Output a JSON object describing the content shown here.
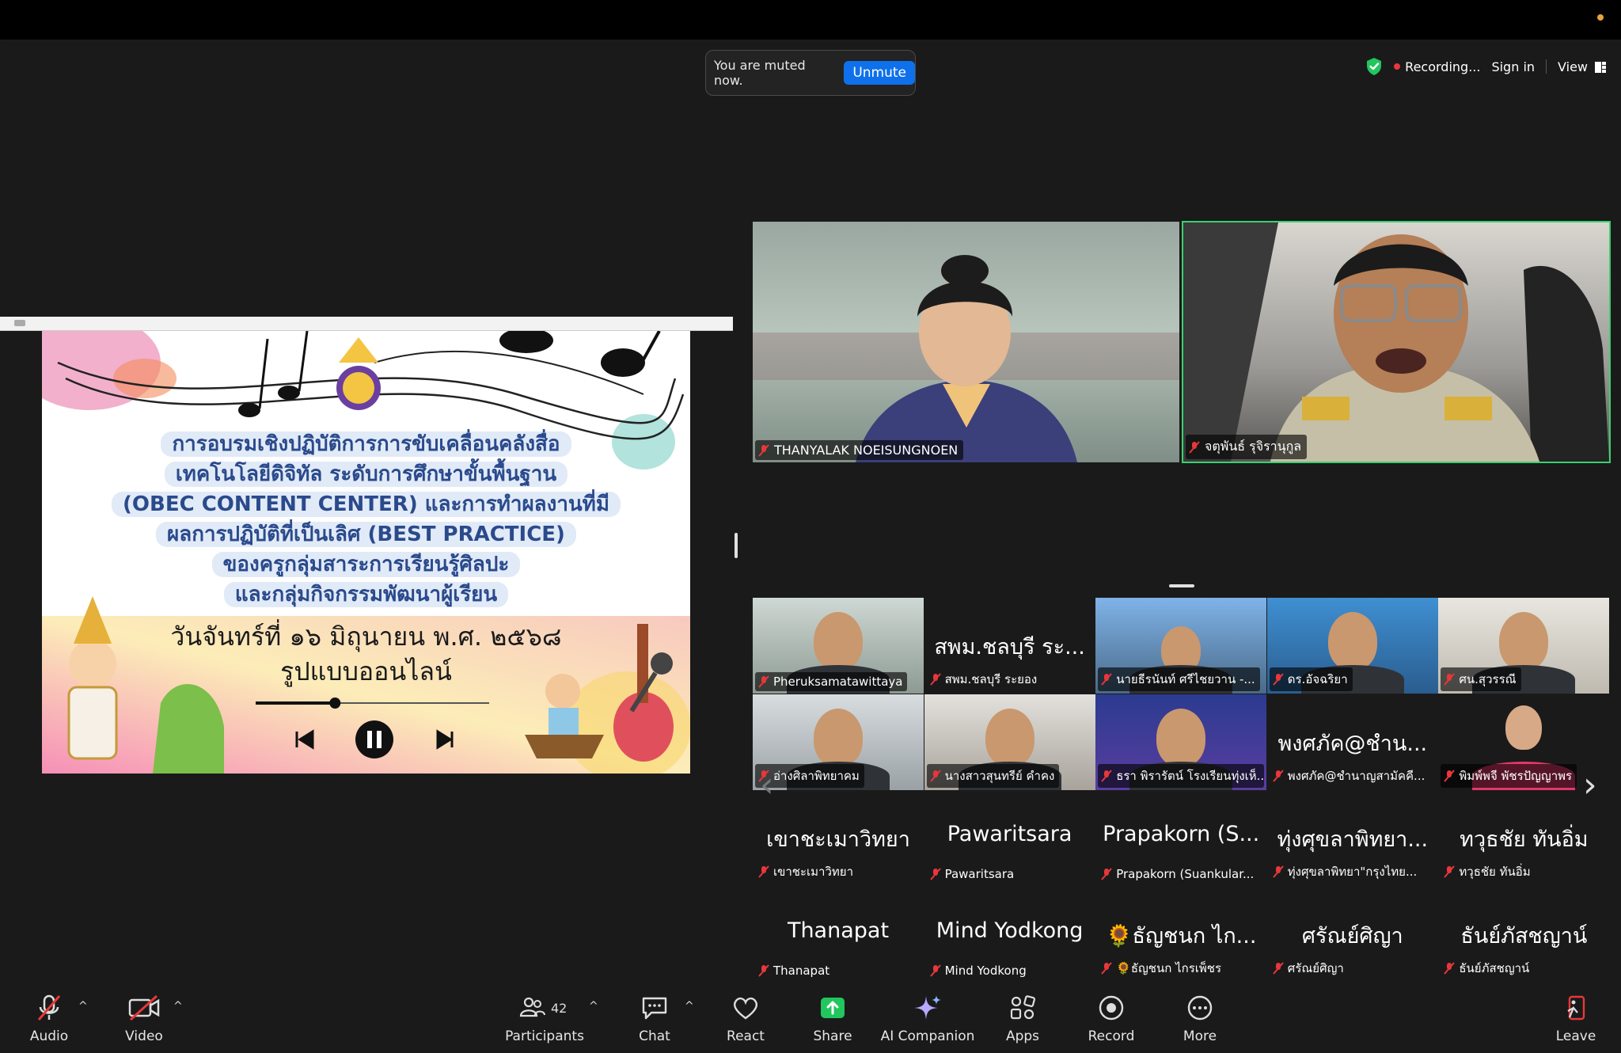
{
  "toast": {
    "message": "You are muted now.",
    "button": "Unmute"
  },
  "topbar": {
    "recording": "Recording...",
    "sign_in": "Sign in",
    "view": "View"
  },
  "slide": {
    "title_lines": [
      "การอบรมเชิงปฏิบัติการการขับเคลื่อนคลังสื่อ",
      "เทคโนโลยีดิจิทัล ระดับการศึกษาขั้นพื้นฐาน",
      "(OBEC CONTENT CENTER) และการทำผลงานที่มี",
      "ผลการปฏิบัติที่เป็นเลิศ (BEST PRACTICE)",
      "ของครูกลุ่มสาระการเรียนรู้ศิลปะ",
      "และกลุ่มกิจกรรมพัฒนาผู้เรียน"
    ],
    "date": "วันจันทร์ที่ ๑๖ มิถุนายน พ.ศ. ๒๕๖๘",
    "format": "รูปแบบออนไลน์",
    "player_progress": 0.34
  },
  "speakers": [
    {
      "name": "THANYALAK  NOEISUNGNOEN"
    },
    {
      "name": "จตุพันธ์ รุจิรานุกูล"
    }
  ],
  "gallery": [
    {
      "label": "Pheruksamatawittaya",
      "big": "",
      "kind": "video"
    },
    {
      "label": "สพม.ชลบุรี ระยอง",
      "big": "สพม.ชลบุรี ระ...",
      "kind": "text"
    },
    {
      "label": "นายธีรนันท์ ศรีไชยวาน -...",
      "big": "",
      "kind": "video"
    },
    {
      "label": "ดร.อัจฉริยา",
      "big": "",
      "kind": "video"
    },
    {
      "label": "ศน.สุวรรณี",
      "big": "",
      "kind": "video"
    },
    {
      "label": "อ่างศิลาพิทยาคม",
      "big": "",
      "kind": "video"
    },
    {
      "label": "นางสาวสุนทรีย์ คำคง",
      "big": "",
      "kind": "video"
    },
    {
      "label": "ธรา พิรารัตน์ โรงเรียนทุ่งเห็...",
      "big": "",
      "kind": "video"
    },
    {
      "label": "พงศภัค@ชำนาญสามัคคี...",
      "big": "พงศภัค@ชำน...",
      "kind": "text"
    },
    {
      "label": "พิมพ์พจี พัชรปัญญาพร",
      "big": "",
      "kind": "video"
    },
    {
      "label": "เขาชะเมาวิทยา",
      "big": "เขาชะเมาวิทยา",
      "kind": "text"
    },
    {
      "label": "Pawaritsara",
      "big": "Pawaritsara",
      "kind": "text"
    },
    {
      "label": "Prapakorn (Suankular...",
      "big": "Prapakorn (S...",
      "kind": "text"
    },
    {
      "label": "ทุ่งศุขลาพิทยา\"กรุงไทย...",
      "big": "ทุ่งศุขลาพิทยา...",
      "kind": "text"
    },
    {
      "label": "ทวุธชัย ทันอิ่ม",
      "big": "ทวุธชัย ทันอิ่ม",
      "kind": "text"
    },
    {
      "label": "Thanapat",
      "big": "Thanapat",
      "kind": "text"
    },
    {
      "label": "Mind Yodkong",
      "big": "Mind Yodkong",
      "kind": "text"
    },
    {
      "label": "🌻ธัญชนก ไกรเพ็ชร",
      "big": "🌻ธัญชนก ไก...",
      "kind": "text"
    },
    {
      "label": "ศรัณย์ศิญา",
      "big": "ศรัณย์ศิญา",
      "kind": "text"
    },
    {
      "label": "ธันย์ภัสชญาน์",
      "big": "ธันย์ภัสชญาน์",
      "kind": "text"
    }
  ],
  "toolbar": {
    "audio": "Audio",
    "video": "Video",
    "participants": "Participants",
    "participants_count": "42",
    "chat": "Chat",
    "react": "React",
    "share": "Share",
    "ai": "AI Companion",
    "apps": "Apps",
    "record": "Record",
    "more": "More",
    "leave": "Leave"
  },
  "colors": {
    "accent": "#0e71eb",
    "active_speaker": "#3bd16f",
    "share_green": "#22c55e",
    "mute_red": "#e8373a"
  }
}
